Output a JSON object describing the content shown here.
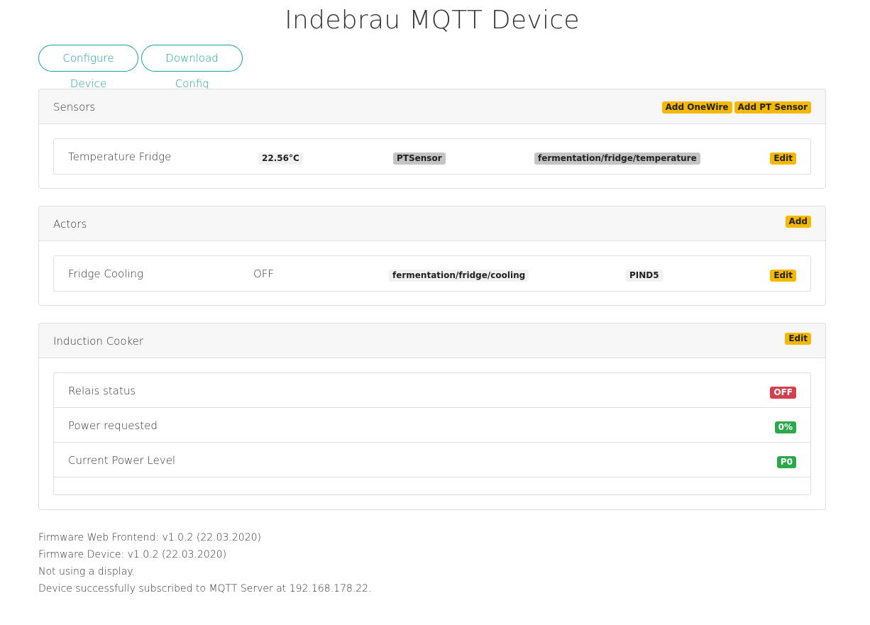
{
  "title": "Indebrau MQTT Device",
  "buttons": {
    "configure": "Configure Device",
    "download": "Download Config"
  },
  "sensors": {
    "header": "Sensors",
    "add_onewire": "Add OneWire",
    "add_pt": "Add PT Sensor",
    "rows": [
      {
        "name": "Temperature Fridge",
        "value": "22.56°C",
        "type": "PTSensor",
        "topic": "fermentation/fridge/temperature",
        "edit": "Edit"
      }
    ]
  },
  "actors": {
    "header": "Actors",
    "add": "Add",
    "rows": [
      {
        "name": "Fridge Cooling",
        "state": "OFF",
        "topic": "fermentation/fridge/cooling",
        "pin": "PIND5",
        "edit": "Edit"
      }
    ]
  },
  "induction": {
    "header": "Induction Cooker",
    "edit": "Edit",
    "rows": [
      {
        "label": "Relais status",
        "value": "OFF",
        "status": "danger"
      },
      {
        "label": "Power requested",
        "value": "0%",
        "status": "success"
      },
      {
        "label": "Current Power Level",
        "value": "P0",
        "status": "success"
      }
    ]
  },
  "footer": {
    "frontend": "Firmware Web Frontend: v1.0.2 (22.03.2020)",
    "device": "Firmware Device: v1.0.2 (22.03.2020)",
    "display": "Not using a display.",
    "mqtt": "Device successfully subscribed to MQTT Server at 192.168.178.22."
  },
  "colors": {
    "accent": "#17a2a4",
    "warning": "#f5b800",
    "danger": "#d43f4d",
    "success": "#2aa84a"
  }
}
